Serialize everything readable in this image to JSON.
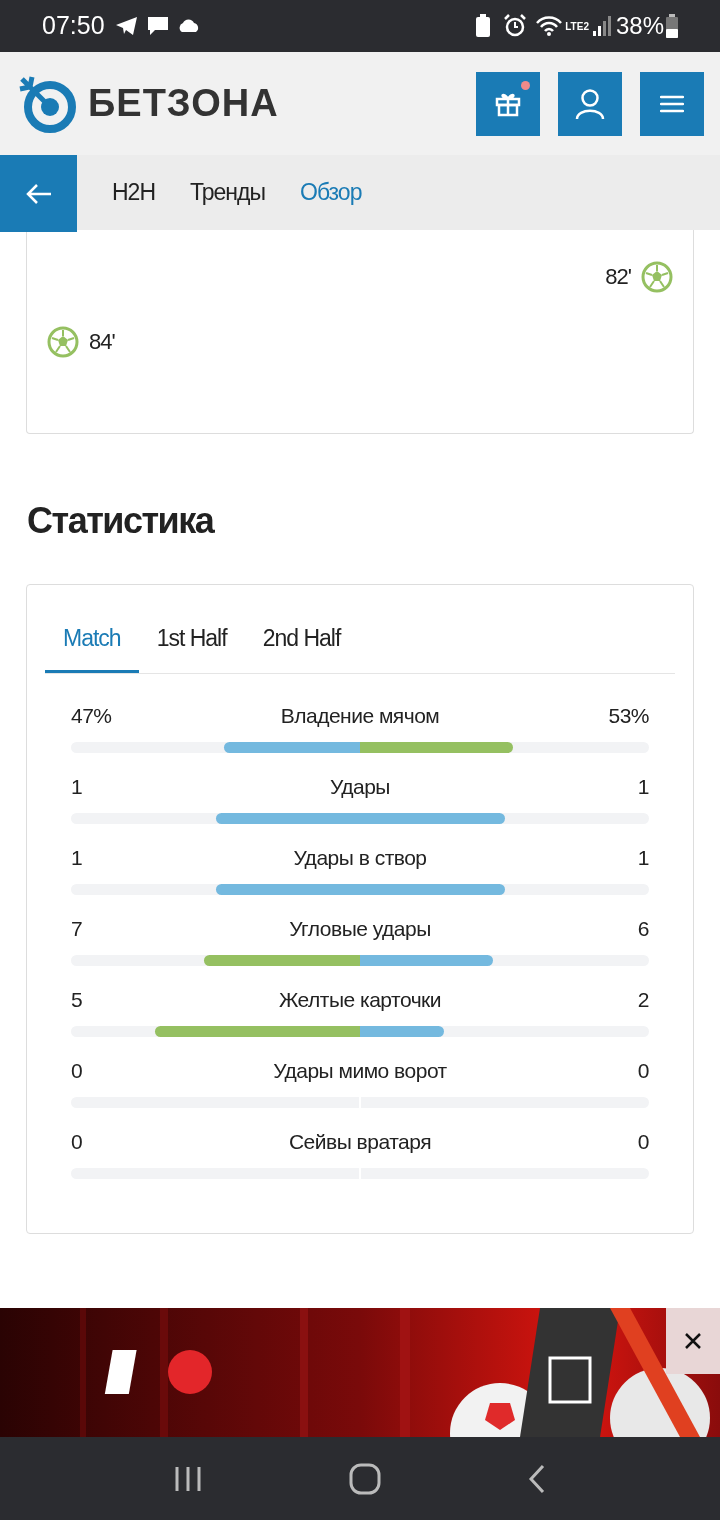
{
  "status_bar": {
    "time": "07:50",
    "battery": "38%",
    "network": "LTE2"
  },
  "header": {
    "logo": "БЕТЗОНА",
    "gift_notification": true
  },
  "nav": {
    "tabs": [
      {
        "label": "H2H",
        "selected": false
      },
      {
        "label": "Тренды",
        "selected": false
      },
      {
        "label": "Обзор",
        "selected": true
      }
    ]
  },
  "events": [
    {
      "kind": "away",
      "minute": "82'"
    },
    {
      "kind": "home",
      "minute": "84'"
    }
  ],
  "statistics": {
    "title": "Статистика",
    "tabs": [
      {
        "label": "Match",
        "selected": true
      },
      {
        "label": "1st Half",
        "selected": false
      },
      {
        "label": "2nd Half",
        "selected": false
      }
    ],
    "rows": [
      {
        "label": "Владение мячом",
        "left": {
          "value": "47%",
          "level": 0.47,
          "color": "#74b9df"
        },
        "right": {
          "value": "53%",
          "level": 0.53,
          "color": "#95c061"
        }
      },
      {
        "label": "Удары",
        "left": {
          "value": "1",
          "level": 0.5,
          "color": "#74b9df"
        },
        "right": {
          "value": "1",
          "level": 0.5,
          "color": "#74b9df"
        }
      },
      {
        "label": "Удары в створ",
        "left": {
          "value": "1",
          "level": 0.5,
          "color": "#74b9df"
        },
        "right": {
          "value": "1",
          "level": 0.5,
          "color": "#74b9df"
        }
      },
      {
        "label": "Угловые удары",
        "left": {
          "value": "7",
          "level": 0.54,
          "color": "#95c061"
        },
        "right": {
          "value": "6",
          "level": 0.46,
          "color": "#74b9df"
        }
      },
      {
        "label": "Желтые карточки",
        "left": {
          "value": "5",
          "level": 0.71,
          "color": "#95c061"
        },
        "right": {
          "value": "2",
          "level": 0.29,
          "color": "#74b9df"
        }
      },
      {
        "label": "Удары мимо ворот",
        "left": {
          "value": "0"
        },
        "right": {
          "value": "0"
        }
      },
      {
        "label": "Сейвы вратаря",
        "left": {
          "value": "0"
        },
        "right": {
          "value": "0"
        }
      }
    ]
  }
}
